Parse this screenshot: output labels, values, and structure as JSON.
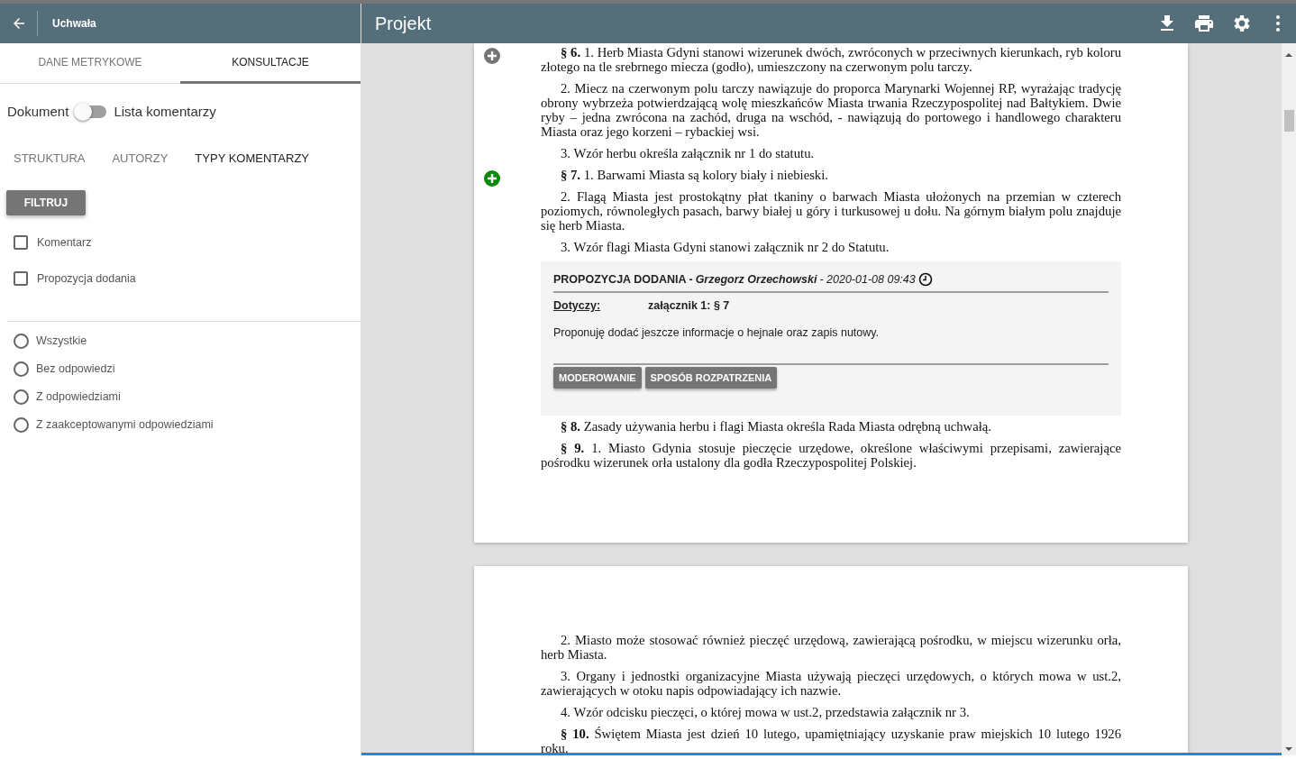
{
  "sidebar": {
    "title": "Uchwała",
    "tabs": [
      {
        "label": "DANE METRYKOWE",
        "selected": false
      },
      {
        "label": "KONSULTACJE",
        "selected": true
      }
    ],
    "view_toggle": {
      "left_label": "Dokument",
      "right_label": "Lista komentarzy",
      "on": false
    },
    "subtabs": [
      {
        "label": "STRUKTURA",
        "selected": false
      },
      {
        "label": "AUTORZY",
        "selected": false
      },
      {
        "label": "TYPY KOMENTARZY",
        "selected": true
      }
    ],
    "filter_button": "FILTRUJ",
    "type_filters": [
      {
        "label": "Komentarz",
        "checked": false
      },
      {
        "label": "Propozycja dodania",
        "checked": false
      }
    ],
    "answer_filters": [
      {
        "label": "Wszystkie",
        "selected": false
      },
      {
        "label": "Bez odpowiedzi",
        "selected": false
      },
      {
        "label": "Z odpowiedziami",
        "selected": false
      },
      {
        "label": "Z zaakceptowanymi odpowiedziami",
        "selected": false
      }
    ]
  },
  "toolbar": {
    "title": "Projekt"
  },
  "pages": [
    {
      "blocks": [
        {
          "kind": "paragraph",
          "marker": {
            "commented": false
          },
          "text": "**§ 6.** 1.  Herb Miasta Gdyni stanowi wizerunek dwóch, zwróconych w przeciwnych kierunkach, ryb koloru złotego na tle srebrnego miecza (godło), umieszczony na czerwonym polu tarczy."
        },
        {
          "kind": "paragraph",
          "text": "2. Miecz na czerwonym polu tarczy nawiązuje do proporca Marynarki Wojennej RP, wyrażając tradycję obrony wybrzeża potwierdzającą wolę mieszkańców Miasta trwania Rzeczypospolitej nad Bałtykiem. Dwie ryby – jedna zwrócona na zachód, druga na wschód, - nawiązują do portowego i handlowego charakteru Miasta oraz jego korzeni – rybackiej wsi."
        },
        {
          "kind": "paragraph",
          "text": "3. Wzór herbu określa załącznik nr 1 do statutu."
        },
        {
          "kind": "paragraph",
          "marker": {
            "commented": true
          },
          "text": "**§ 7.** 1.  Barwami Miasta są kolory biały i niebieski."
        },
        {
          "kind": "paragraph",
          "text": "2. Flagą Miasta jest prostokątny płat tkaniny o barwach Miasta ułożonych na przemian w czterech poziomych, równoległych pasach, barwy białej u góry i turkusowej u dołu. Na górnym białym polu znajduje się herb Miasta."
        },
        {
          "kind": "paragraph",
          "text": "3. Wzór flagi Miasta Gdyni stanowi załącznik nr 2 do Statutu."
        },
        {
          "kind": "comment",
          "type": "PROPOZYCJA DODANIA -",
          "author": "Grzegorz Orzechowski",
          "date": "- 2020-01-08 09:43",
          "concerns_label": "Dotyczy:",
          "concerns": "załącznik 1: § 7",
          "body": "Proponuję dodać jeszcze informacje o hejnale oraz zapis nutowy.",
          "buttons": [
            "MODEROWANIE",
            "SPOSÓB ROZPATRZENIA"
          ]
        },
        {
          "kind": "paragraph",
          "text": "**§ 8.** Zasady używania herbu i flagi Miasta określa Rada Miasta odrębną uchwałą."
        },
        {
          "kind": "paragraph",
          "text": "**§ 9.** 1.  Miasto Gdynia stosuje pieczęcie urzędowe, określone właściwymi przepisami, zawierające pośrodku wizerunek orła ustalony dla godła Rzeczypospolitej Polskiej."
        }
      ]
    },
    {
      "blocks": [
        {
          "kind": "paragraph",
          "text": "2. Miasto może stosować również pieczęć urzędową, zawierającą pośrodku, w miejscu wizerunku orła, herb Miasta."
        },
        {
          "kind": "paragraph",
          "text": "3. Organy i jednostki organizacyjne Miasta używają pieczęci urzędowych, o których mowa w ust.2, zawierających w otoku napis odpowiadający ich nazwie."
        },
        {
          "kind": "paragraph",
          "text": "4. Wzór odcisku pieczęci, o której mowa w ust.2, przedstawia załącznik nr 3."
        },
        {
          "kind": "paragraph",
          "text": "**§ 10.** Świętem Miasta jest dzień 10 lutego, upamiętniający uzyskanie praw miejskich 10 lutego 1926 roku."
        }
      ]
    }
  ]
}
